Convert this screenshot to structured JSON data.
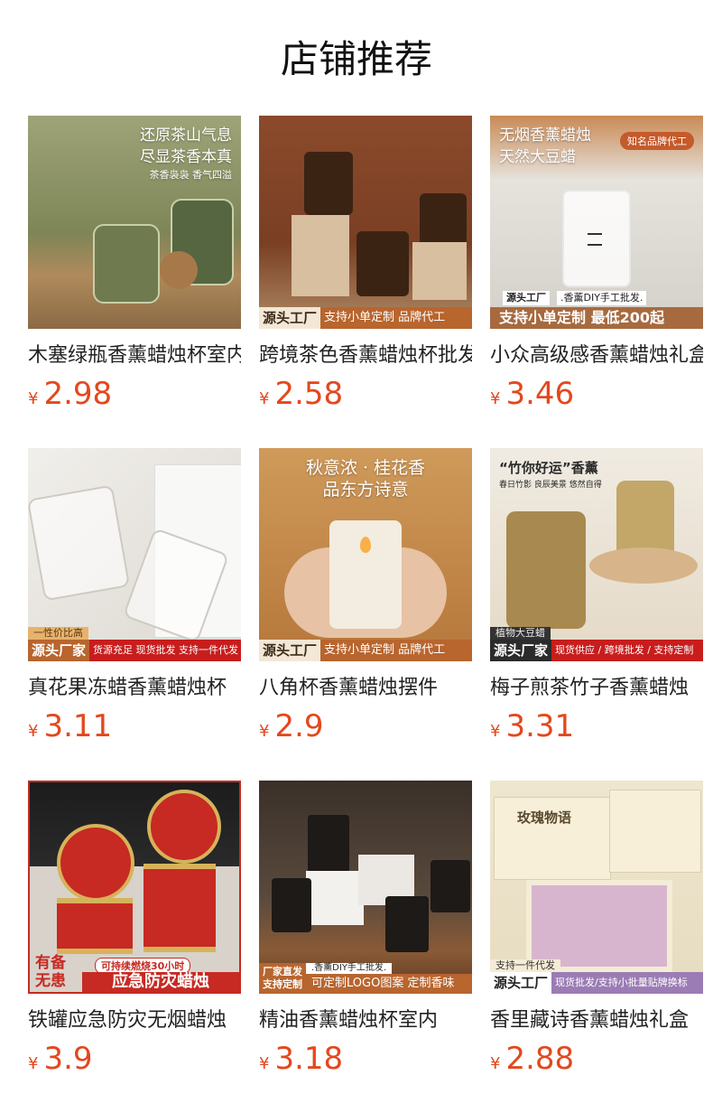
{
  "page": {
    "title": "店铺推荐"
  },
  "products": [
    {
      "name": "木塞绿瓶香薰蜡烛杯室内",
      "currency": "¥",
      "price": "2.98",
      "image": {
        "caption_lines": [
          "还原茶山气息",
          "尽显茶香本真",
          "茶香袅袅 香气四溢"
        ],
        "bg": "#8a8f63",
        "accent": "#5b6a43"
      }
    },
    {
      "name": "跨境茶色香薰蜡烛杯批发",
      "currency": "¥",
      "price": "2.58",
      "image": {
        "strip_a": "源头工厂",
        "strip_b": "支持小单定制 品牌代工",
        "bg": "#8b4a2b",
        "accent": "#3b2314"
      }
    },
    {
      "name": "小众高级感香薰蜡烛礼盒",
      "currency": "¥",
      "price": "3.46",
      "image": {
        "caption_lines": [
          "无烟香薰蜡烛",
          "天然大豆蜡"
        ],
        "badge": "知名品牌代工",
        "strip_a": "源头工厂",
        "strip_b": ".香薰DIY手工批发.",
        "strip_main": "支持小单定制 最低200起",
        "bg": "#cfcbc6",
        "accent": "#a76a3f"
      }
    },
    {
      "name": "真花果冻蜡香薰蜡烛杯",
      "currency": "¥",
      "price": "3.11",
      "image": {
        "sub": "一性价比高",
        "strip_a": "源头厂家",
        "strip_b": "货源充足 现货批发 支持一件代发",
        "bg": "#e9e6e1",
        "accent": "#8f8a80"
      }
    },
    {
      "name": "八角杯香薰蜡烛摆件",
      "currency": "¥",
      "price": "2.9",
      "image": {
        "caption_lines": [
          "秋意浓 · 桂花香",
          "品东方诗意"
        ],
        "strip_a": "源头工厂",
        "strip_b": "支持小单定制 品牌代工",
        "bg": "#c9904f",
        "accent": "#f1ead9"
      }
    },
    {
      "name": "梅子煎茶竹子香薰蜡烛",
      "currency": "¥",
      "price": "3.31",
      "image": {
        "caption_lines": [
          "“竹你好运”香薰",
          "春日竹影 良辰美景 悠然自得"
        ],
        "sub": "植物大豆蜡",
        "strip_a": "源头厂家",
        "strip_b": "现货供应 / 跨境批发 / 支持定制",
        "bg": "#ece4d6",
        "accent": "#b89a5d"
      }
    },
    {
      "name": "铁罐应急防灾无烟蜡烛",
      "currency": "¥",
      "price": "3.9",
      "image": {
        "top_left": "有备",
        "bottom_left": "无患",
        "tag": "可持续燃烧30小时",
        "main": "应急防灾蜡烛",
        "bg": "#d8d2cb",
        "accent": "#c62a22"
      }
    },
    {
      "name": "精油香薰蜡烛杯室内",
      "currency": "¥",
      "price": "3.18",
      "image": {
        "strip_a_top": "厂家直发",
        "strip_a_bottom": "支持定制",
        "strip_b_top": ".香薰DIY手工批发.",
        "strip_b": "可定制LOGO图案 定制香味",
        "bg": "#5a4a3d",
        "accent": "#1d1a17"
      }
    },
    {
      "name": "香里藏诗香薰蜡烛礼盒",
      "currency": "¥",
      "price": "2.88",
      "image": {
        "caption_lines": [
          "玫瑰物语"
        ],
        "sub": "支持一件代发",
        "strip_a": "源头工厂",
        "strip_b": "现货批发/支持小批量贴牌换标",
        "bg": "#efe6cf",
        "accent": "#9b7cb4"
      }
    }
  ]
}
